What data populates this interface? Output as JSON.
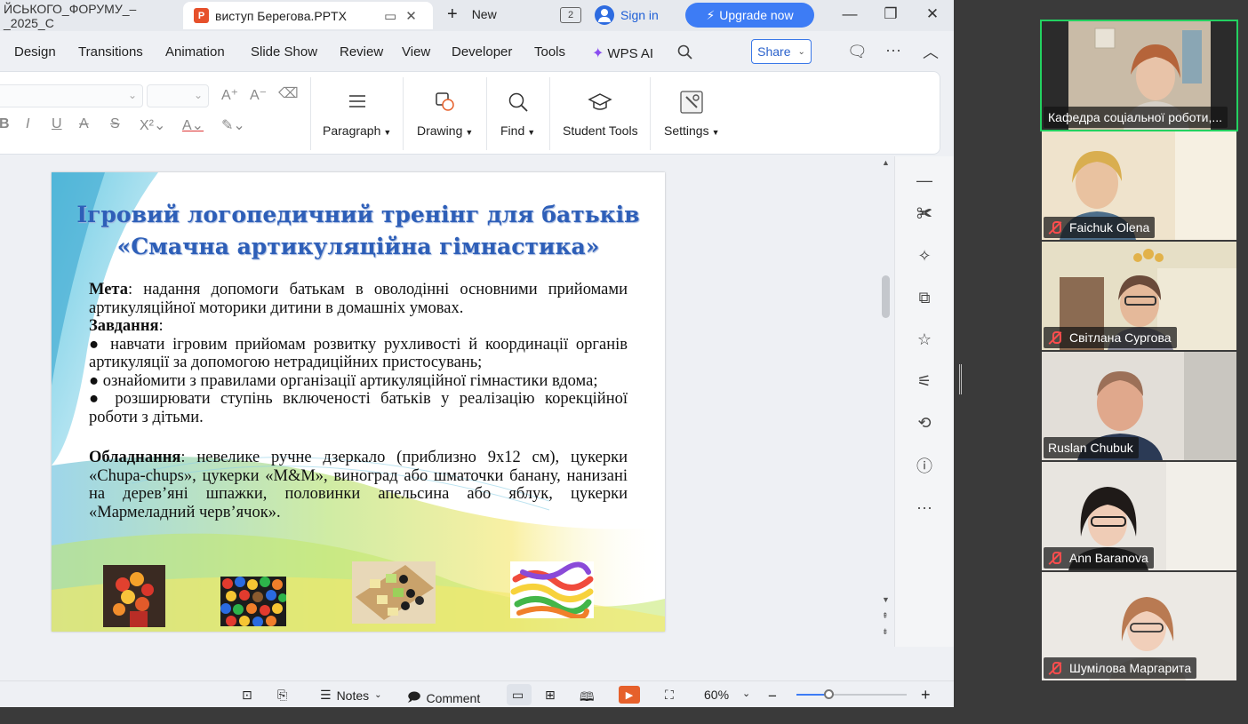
{
  "tabs": {
    "previous_title": "ЙСЬКОГО_ФОРУМУ_–_2025_С",
    "active_title": "виступ Берегова.PPTX",
    "app_icon_letter": "P",
    "new_label": "New",
    "tab_count": "2"
  },
  "account": {
    "sign_in": "Sign in",
    "upgrade": "Upgrade now"
  },
  "menu": {
    "items": [
      "Design",
      "Transitions",
      "Animation",
      "Slide Show",
      "Review",
      "View",
      "Developer",
      "Tools"
    ],
    "wps_ai": "WPS AI",
    "share": "Share"
  },
  "ribbon": {
    "paragraph": "Paragraph",
    "drawing": "Drawing",
    "find": "Find",
    "student_tools": "Student Tools",
    "settings": "Settings"
  },
  "slide": {
    "title_line1": "Ігровий логопедичний тренінг для батьків",
    "title_line2": "«Смачна артикуляційна гімнастика»",
    "goal_label": "Мета",
    "goal_text": ": надання допомоги батькам в оволодінні основними прийомами артикуляційної моторики дитини в домашніх умовах.",
    "tasks_label": "Завдання",
    "tasks_colon": ":",
    "tasks": [
      "● навчати ігровим прийомам розвитку рухливості й координації органів артикуляції за допомогою нетрадиційних пристосувань;",
      "● ознайомити з правилами організації артикуляційної гімнастики вдома;",
      "● розширювати ступінь включеності батьків у реалізацію корекційної роботи з дітьми."
    ],
    "equipment_label": "Обладнання",
    "equipment_text": ": невелике ручне дзеркало (приблизно 9х12 см), цукерки «Chupa-chups», цукерки «M&M», виноград або шматочки банану, нанизані на дерев’яні шпажки, половинки апельсина або яблук, цукерки «Мармеладний черв’ячок»."
  },
  "statusbar": {
    "notes": "Notes",
    "comment": "Comment",
    "zoom": "60%",
    "zoom_level": 0.3
  },
  "participants": [
    {
      "name": "Кафедра соціальної роботи,...",
      "muted": false,
      "active": true
    },
    {
      "name": "Faichuk Olena",
      "muted": true,
      "active": false
    },
    {
      "name": "Світлана Сургова",
      "muted": true,
      "active": false
    },
    {
      "name": "Ruslan Chubuk",
      "muted": false,
      "active": false
    },
    {
      "name": "Ann Baranova",
      "muted": true,
      "active": false
    },
    {
      "name": "Шумілова Маргарита",
      "muted": true,
      "active": false
    }
  ],
  "colors": {
    "accent": "#3d7cf5",
    "active_speaker": "#23d160",
    "slide_title": "#2e5fb8",
    "ppt_brand": "#e6502b"
  },
  "icons": [
    "search-icon",
    "comment-icon",
    "more-icon",
    "close-icon",
    "minimize-icon",
    "restore-icon",
    "play-icon",
    "mic-off-icon"
  ]
}
